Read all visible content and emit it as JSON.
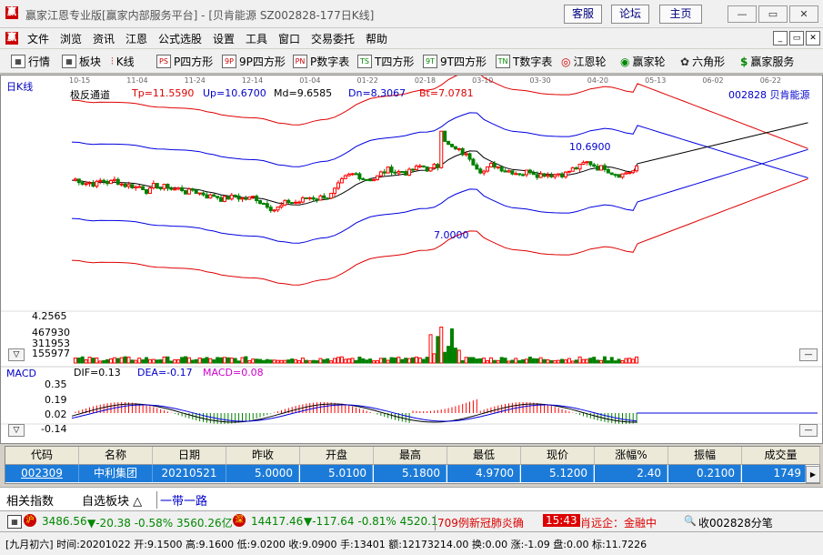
{
  "window": {
    "title": "赢家江恩专业版[赢家内部服务平台] - [贝肯能源  SZ002828-177日K线]",
    "buttons": [
      "客服",
      "论坛",
      "主页"
    ]
  },
  "menu": [
    "文件",
    "浏览",
    "资讯",
    "江恩",
    "公式选股",
    "设置",
    "工具",
    "窗口",
    "交易委托",
    "帮助"
  ],
  "toolbar": [
    {
      "label": "行情",
      "icon": "grid-icon"
    },
    {
      "label": "板块",
      "icon": "blocks-icon"
    },
    {
      "label": "K线",
      "icon": "candle-icon"
    },
    {
      "label": "P四方形",
      "icon": "p-square-icon"
    },
    {
      "label": "9P四方形",
      "icon": "9p-square-icon"
    },
    {
      "label": "P数字表",
      "icon": "p-table-icon"
    },
    {
      "label": "T四方形",
      "icon": "t-square-icon"
    },
    {
      "label": "9T四方形",
      "icon": "9t-square-icon"
    },
    {
      "label": "T数字表",
      "icon": "t-table-icon"
    },
    {
      "label": "江恩轮",
      "icon": "wheel-icon"
    },
    {
      "label": "赢家轮",
      "icon": "big-wheel-icon"
    },
    {
      "label": "六角形",
      "icon": "hexagon-icon"
    },
    {
      "label": "赢家服务",
      "icon": "dollar-icon"
    }
  ],
  "chart_data": {
    "type": "candlestick",
    "period_label": "日K线",
    "dates": [
      "10-15",
      "11-04",
      "11-24",
      "12-14",
      "01-04",
      "01-22",
      "02-18",
      "03-10",
      "03-30",
      "04-20",
      "05-13",
      "06-02",
      "06-22"
    ],
    "indicator": {
      "name": "极反通道",
      "Tp": "Tp=11.5590",
      "Up": "Up=10.6700",
      "Md": "Md=9.6585",
      "Dn": "Dn=8.3067",
      "Bt": "Bt=7.0781"
    },
    "stock": "002828  贝肯能源",
    "annotations": {
      "high": "10.6900",
      "low": "7.0000"
    },
    "volume_axis": [
      "4.2565",
      "467930",
      "311953",
      "155977"
    ],
    "macd": {
      "name": "MACD",
      "DIF": "DIF=0.13",
      "DEA": "DEA=-0.17",
      "MACD": "MACD=0.08",
      "axis": [
        "0.35",
        "0.19",
        "0.02",
        "-0.14"
      ]
    },
    "colors": {
      "up": "#ff0000",
      "down": "#008000",
      "mid": "#000000",
      "band": "#0000ff",
      "outer": "#ff0000"
    }
  },
  "table": {
    "headers": [
      "代码",
      "名称",
      "日期",
      "昨收",
      "开盘",
      "最高",
      "最低",
      "现价",
      "涨幅%",
      "振幅",
      "成交量"
    ],
    "row": [
      "002309",
      "中利集团",
      "20210521",
      "5.0000",
      "5.0100",
      "5.1800",
      "4.9700",
      "5.1200",
      "2.40",
      "0.2100",
      "1749"
    ]
  },
  "tabs": [
    "相关指数",
    "自选板块 △",
    "一带一路"
  ],
  "status": {
    "sh": "3486.56",
    "sh_change": "▼-20.38 -0.58% 3560.26亿",
    "sz": "14417.46",
    "sz_change": "▼-117.64 -0.81% 4520.1",
    "news": "709例新冠肺炎确",
    "time": "15:43",
    "news2": "肖远企：金融中",
    "fav": "收002828分笔",
    "line2": "[九月初六] 时间:20201022 开:9.1500 高:9.1600 低:9.0200 收:9.0900 手:13401 额:12173214.00 换:0.00 涨:-1.09 盘:0.00 标:11.7226"
  }
}
